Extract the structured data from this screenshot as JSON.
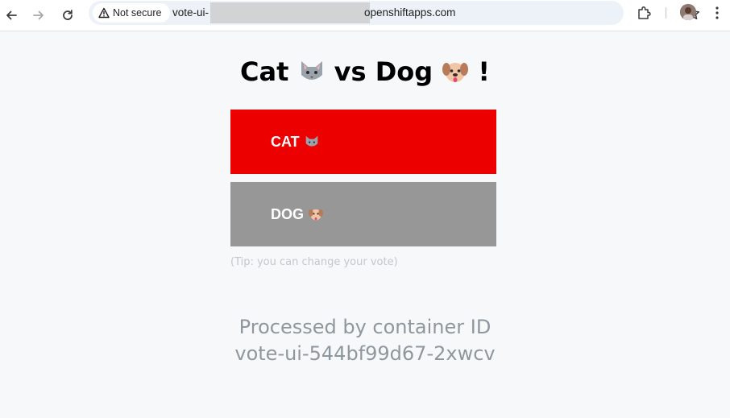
{
  "browser": {
    "security_label": "Not secure",
    "url_prefix": "vote-ui-",
    "url_suffix": "openshiftapps.com"
  },
  "page": {
    "title_cat": "Cat",
    "title_vs": "vs Dog",
    "title_bang": "!",
    "cat_button_label": "CAT",
    "dog_button_label": "DOG",
    "tip": "(Tip: you can change your vote)",
    "processed_line1": "Processed by container ID",
    "processed_line2": "vote-ui-544bf99d67-2xwcv"
  },
  "colors": {
    "cat_button": "#ec0000",
    "dog_button": "#979797",
    "background": "#f7f8f9"
  },
  "icons": [
    "back-arrow-icon",
    "forward-arrow-icon",
    "reload-icon",
    "warning-icon",
    "star-icon",
    "extension-puzzle-icon",
    "kebab-menu-icon",
    "cat-emoji-icon",
    "dog-emoji-icon"
  ]
}
